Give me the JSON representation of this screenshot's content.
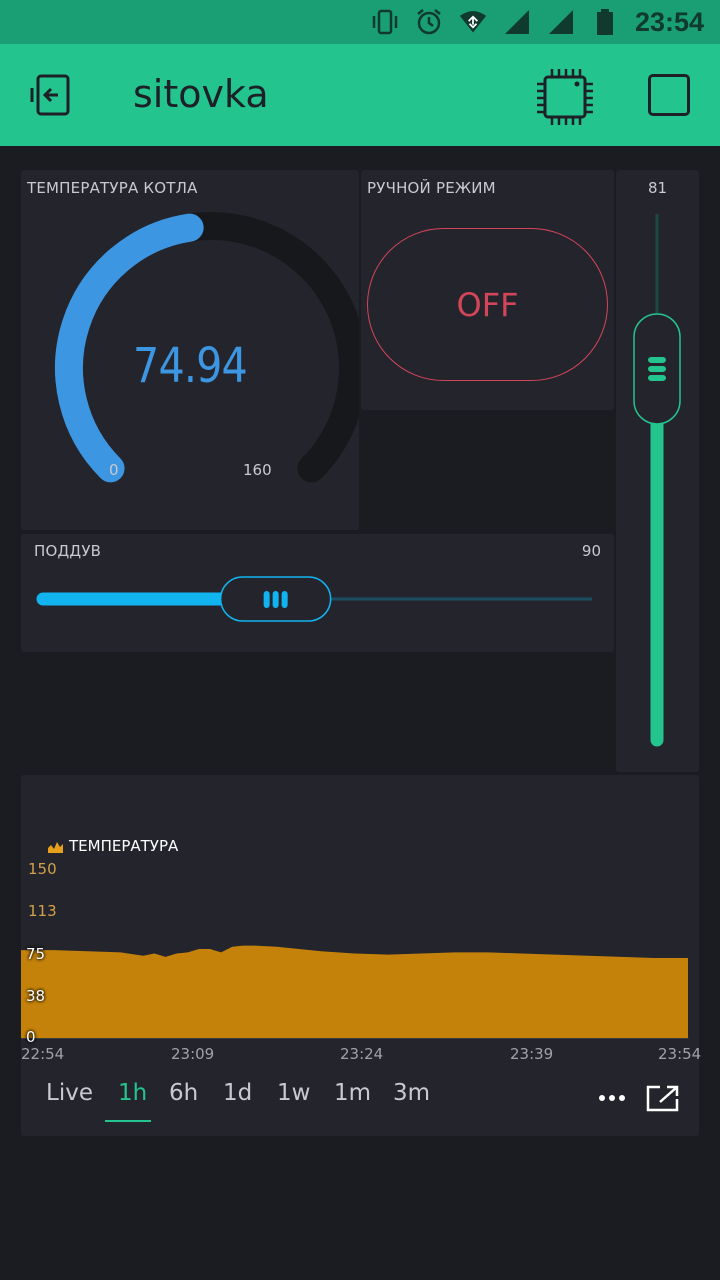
{
  "status_bar": {
    "time": "23:54"
  },
  "app": {
    "title": "sitovka"
  },
  "gauge": {
    "label": "ТЕМПЕРАТУРА КОТЛА",
    "value": "74.94",
    "min": "0",
    "max": "160",
    "fill_fraction": 0.468,
    "color": "#3d96e2"
  },
  "manual_mode": {
    "label": "РУЧНОЙ РЕЖИМ",
    "state": "OFF",
    "color": "#d4455a"
  },
  "vertical_slider": {
    "value": "81",
    "fill_fraction": 0.81,
    "color": "#23c48e"
  },
  "horizontal_slider": {
    "label": "ПОДДУВ",
    "value": "90",
    "fill_fraction": 0.36,
    "color": "#12b4f0"
  },
  "chart": {
    "legend": "ТЕМПЕРАТУРА",
    "y_ticks": [
      "150",
      "113",
      "75",
      "38",
      "0"
    ],
    "x_ticks": [
      "22:54",
      "23:09",
      "23:24",
      "23:39",
      "23:54"
    ],
    "tabs": [
      "Live",
      "1h",
      "6h",
      "1d",
      "1w",
      "1m",
      "3m"
    ],
    "active_tab": "1h",
    "more_icon": "more-horizontal-icon",
    "expand_icon": "expand-icon",
    "color": "#c4820a"
  },
  "chart_data": {
    "type": "area",
    "series": [
      {
        "name": "ТЕМПЕРАТУРА",
        "x": [
          "22:54",
          "22:57",
          "23:00",
          "23:03",
          "23:05",
          "23:06",
          "23:07",
          "23:08",
          "23:09",
          "23:10",
          "23:11",
          "23:12",
          "23:13",
          "23:14",
          "23:15",
          "23:17",
          "23:19",
          "23:21",
          "23:24",
          "23:27",
          "23:30",
          "23:33",
          "23:36",
          "23:39",
          "23:42",
          "23:45",
          "23:48",
          "23:51",
          "23:54"
        ],
        "y": [
          78,
          78,
          77,
          76,
          73,
          75,
          72,
          75,
          76,
          79,
          79,
          76,
          81,
          82,
          82,
          81,
          79,
          77,
          75,
          74,
          75,
          76,
          76,
          75,
          74,
          73,
          72,
          71,
          71
        ]
      }
    ],
    "ylim": [
      0,
      150
    ],
    "xlim": [
      "22:54",
      "23:54"
    ],
    "grid": false,
    "legend_position": "top-left"
  }
}
